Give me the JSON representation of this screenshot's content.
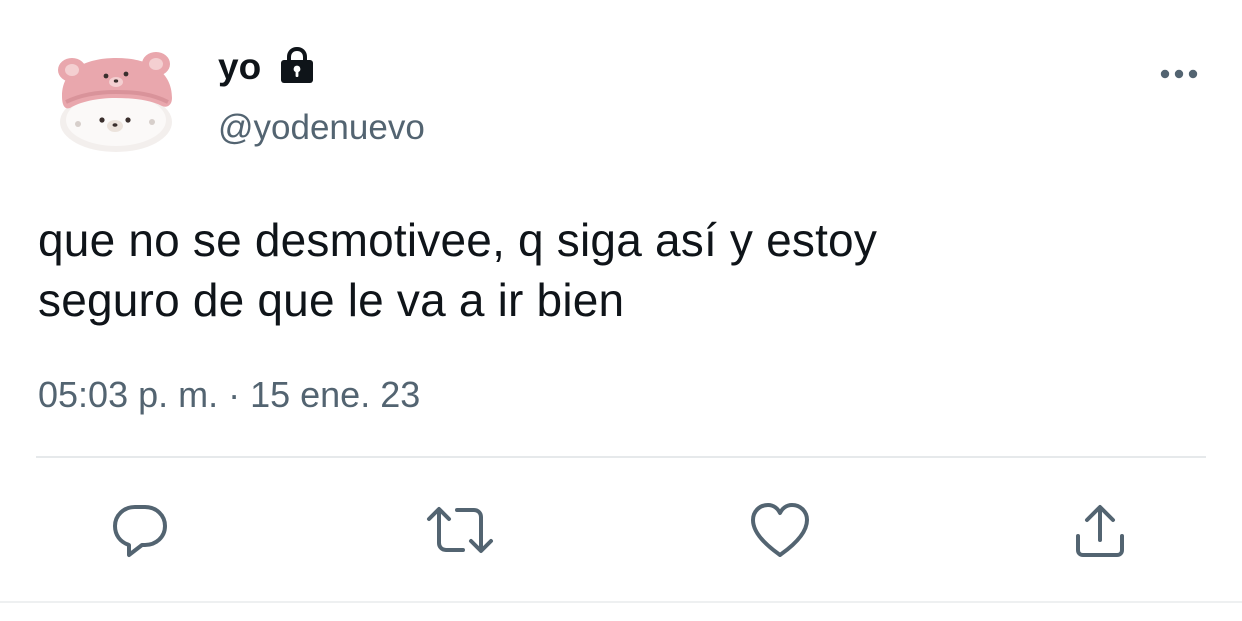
{
  "tweet": {
    "display_name": "yo",
    "handle": "@yodenuevo",
    "text": "que no se desmotivee, q siga así y estoy\nseguro de que le va a ir bien",
    "timestamp": "05:03 p. m. · 15 ene. 23"
  },
  "icons": {
    "lock": "lock-icon",
    "more": "more-icon",
    "reply": "reply-icon",
    "retweet": "retweet-icon",
    "like": "heart-icon",
    "share": "share-icon"
  },
  "colors": {
    "text_primary": "#0f1419",
    "text_secondary": "#536471",
    "divider": "#e6e9eb",
    "avatar_pink": "#e9a7ad",
    "avatar_white": "#f7f4f2"
  }
}
